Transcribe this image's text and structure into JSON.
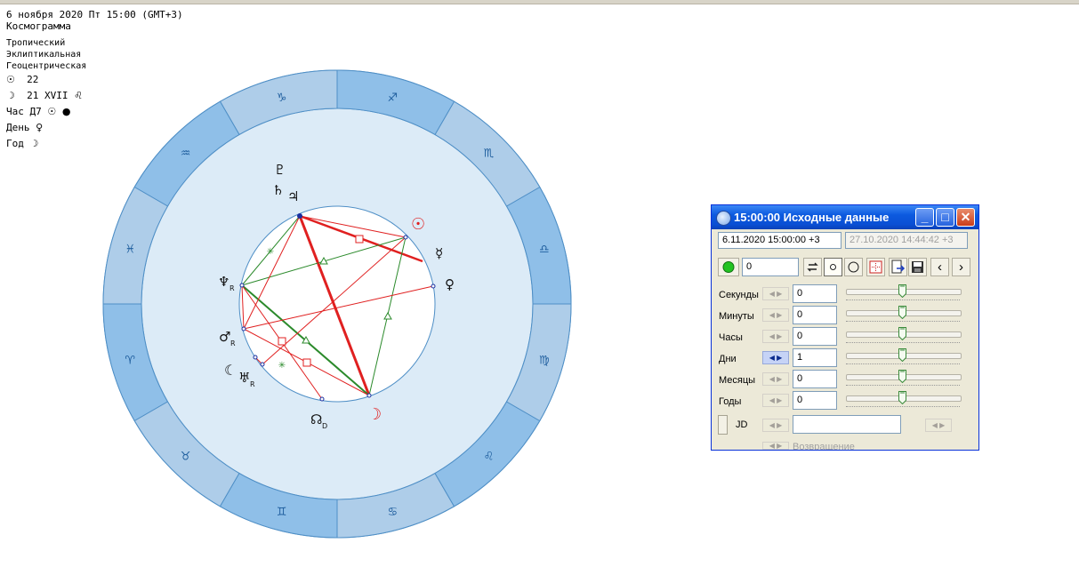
{
  "header": {
    "date_line": "6 ноября 2020  Пт  15:00 (GMT+3)",
    "chart_kind": "Космограмма",
    "zodiac": "Тропический",
    "coords": "Эклиптикальная",
    "center": "Геоцентрическая",
    "sun_line": "22",
    "moon_line": "21 XVII",
    "hour_label": "Час Д7",
    "day_label": "День",
    "year_label": "Год"
  },
  "chart": {
    "signs": [
      "♈",
      "♉",
      "♊",
      "♋",
      "♌",
      "♍",
      "♎",
      "♏",
      "♐",
      "♑",
      "♒",
      "♓"
    ],
    "planets": {
      "sun": "☉",
      "moon": "☽",
      "mercury": "☿",
      "venus": "♀",
      "mars": "♂",
      "jupiter": "♃",
      "saturn": "♄",
      "uranus": "♅",
      "neptune": "♆",
      "pluto": "♇",
      "node": "☊",
      "lilith": "☾"
    },
    "retro": "R",
    "direct": "D"
  },
  "dialog": {
    "title": "15:00:00 Исходные данные",
    "main_datetime": "6.11.2020  15:00:00  +3",
    "ref_datetime": "27.10.2020   14:44:42  +3",
    "step_value": "0",
    "rows": [
      {
        "label": "Секунды",
        "value": "0"
      },
      {
        "label": "Минуты",
        "value": "0"
      },
      {
        "label": "Часы",
        "value": "0"
      },
      {
        "label": "Дни",
        "value": "1"
      },
      {
        "label": "Месяцы",
        "value": "0"
      },
      {
        "label": "Годы",
        "value": "0"
      }
    ],
    "jd_label": "JD",
    "bottom_label": "Возвращение",
    "min_glyph": "_",
    "max_glyph": "□",
    "close_glyph": "✕",
    "prev_glyph": "‹",
    "next_glyph": "›"
  },
  "colors": {
    "ring_outer": "#aecde9",
    "ring_blue": "#8fbfe8",
    "ring_inner": "#dcebf7",
    "accent": "#0a4fd4",
    "aspect_red": "#e02020",
    "aspect_green": "#2b8a2b"
  }
}
